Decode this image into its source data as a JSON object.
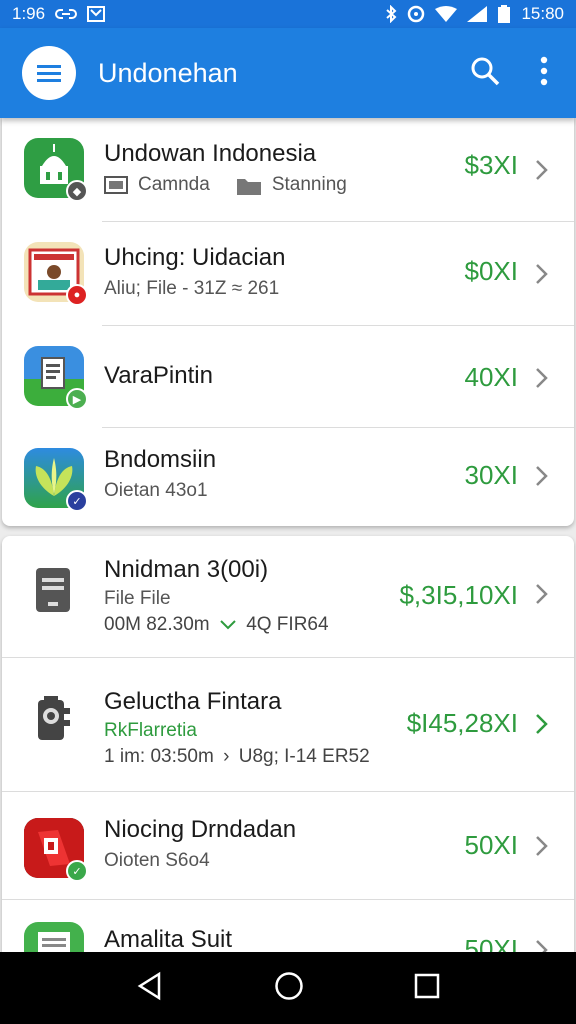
{
  "status_bar": {
    "time_left": "1:96",
    "time_right": "15:80",
    "icons": [
      "link-icon",
      "mail-icon",
      "bluetooth-icon",
      "alarm-icon",
      "wifi-icon",
      "signal-icon",
      "battery-icon"
    ]
  },
  "app_bar": {
    "title": "Undonehan",
    "icons": [
      "menu-icon",
      "search-icon",
      "more-vert-icon"
    ]
  },
  "list_top": [
    {
      "title": "Undowan  Indonesia",
      "sub1": "Camnda",
      "sub2": "Stanning",
      "price": "$3XI"
    },
    {
      "title": "Uhcing: Uidacian",
      "sub": "Aliu; File - 31Z ≈ 261",
      "price": "$0XI"
    },
    {
      "title": "VaraPintin",
      "price": "40XI"
    },
    {
      "title": "Bndomsiin",
      "sub": "Oietan 43o1",
      "price": "30XI"
    }
  ],
  "list_bottom": [
    {
      "title": "Nnidman 3(00i)",
      "sub": "File File",
      "meta_a": "00M 82.30m",
      "meta_b": "4Q  FIR64",
      "price": "$,3I5,10XI"
    },
    {
      "title": "Geluctha Fintara",
      "sub": "RkFlarretia",
      "meta_a": "1 im: 03:50m",
      "meta_b": "U8g; I-14 ER52",
      "price": "$I45,28XI"
    },
    {
      "title": "Niocing Drndadan",
      "sub": "Oioten S6o4",
      "price": "50XI"
    },
    {
      "title": "Amalita Suit",
      "price": "50XI"
    }
  ],
  "colors": {
    "primary": "#1e7fe0",
    "status": "#1a73d9",
    "price_green": "#2e9b3e"
  }
}
